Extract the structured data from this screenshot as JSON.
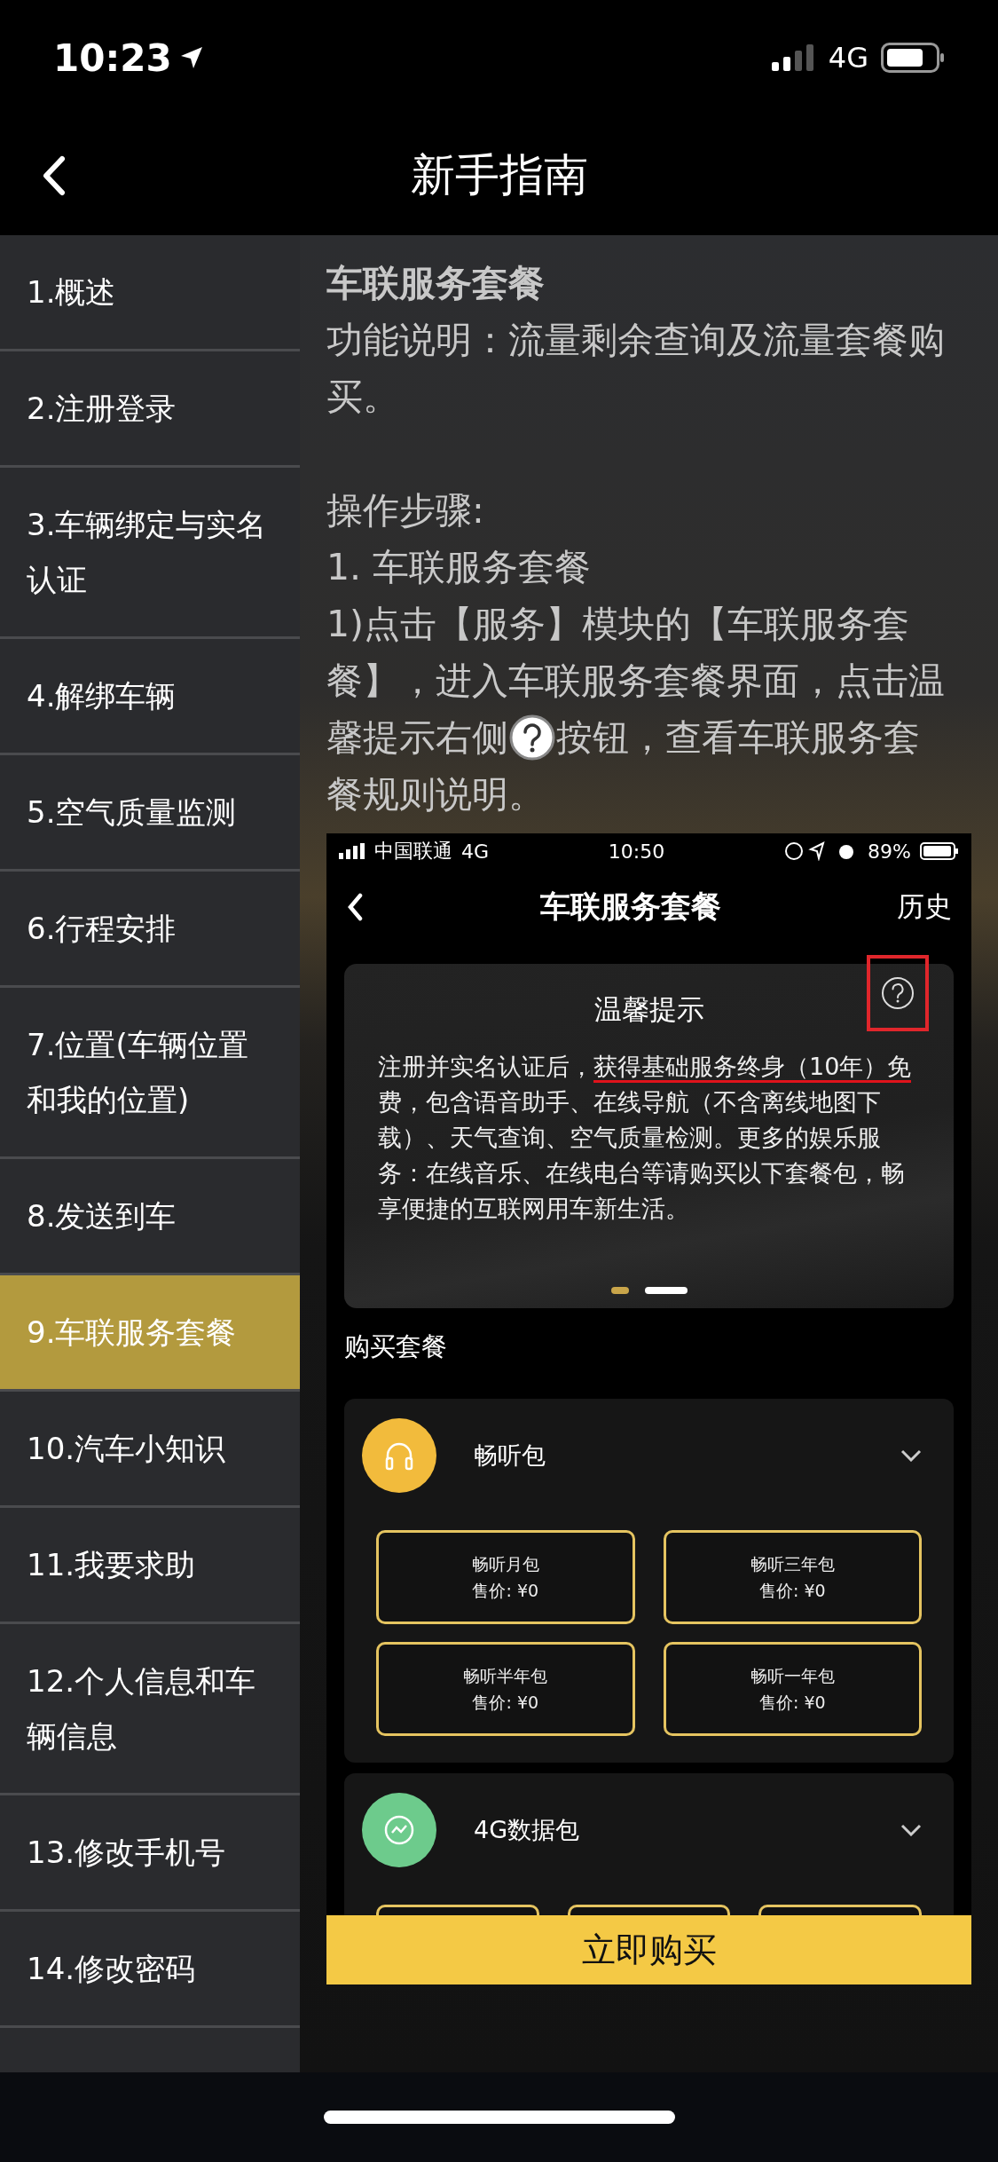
{
  "status_bar": {
    "time": "10:23",
    "network": "4G"
  },
  "nav": {
    "title": "新手指南"
  },
  "sidebar": {
    "items": [
      {
        "label": "1.概述",
        "selected": false
      },
      {
        "label": "2.注册登录",
        "selected": false
      },
      {
        "label": "3.车辆绑定与实名认证",
        "selected": false
      },
      {
        "label": "4.解绑车辆",
        "selected": false
      },
      {
        "label": "5.空气质量监测",
        "selected": false
      },
      {
        "label": "6.行程安排",
        "selected": false
      },
      {
        "label": "7.位置(车辆位置和我的位置)",
        "selected": false
      },
      {
        "label": "8.发送到车",
        "selected": false
      },
      {
        "label": "9.车联服务套餐",
        "selected": true
      },
      {
        "label": "10.汽车小知识",
        "selected": false
      },
      {
        "label": "11.我要求助",
        "selected": false
      },
      {
        "label": "12.个人信息和车辆信息",
        "selected": false
      },
      {
        "label": "13.修改手机号",
        "selected": false
      },
      {
        "label": "14.修改密码",
        "selected": false
      }
    ]
  },
  "content": {
    "heading": "车联服务套餐",
    "description": "功能说明：流量剩余查询及流量套餐购买。",
    "steps_label": "操作步骤:",
    "step_title": "1. 车联服务套餐",
    "step_lines": [
      {
        "parts": [
          {
            "kind": "text",
            "text": "1)点击【服务】模块的【车联服务套"
          }
        ]
      },
      {
        "parts": [
          {
            "kind": "text",
            "text": "餐】，进入车联服务套餐界面，点击温"
          }
        ]
      },
      {
        "parts": [
          {
            "kind": "text",
            "text": "馨提示右侧"
          },
          {
            "kind": "help_icon"
          },
          {
            "kind": "text",
            "text": "按钮，查看车联服务套"
          }
        ]
      },
      {
        "parts": [
          {
            "kind": "text",
            "text": "餐规则说明。"
          }
        ]
      }
    ]
  },
  "embedded_screenshot": {
    "status_bar": {
      "carrier": "中国联通",
      "network": "4G",
      "time": "10:50",
      "battery": "89%"
    },
    "nav": {
      "title": "车联服务套餐",
      "action": "历史"
    },
    "notice": {
      "title": "温馨提示",
      "help_highlighted": true,
      "text_parts": [
        {
          "text": "注册并实名认证后，",
          "marked": false
        },
        {
          "text": "获得基础服务终身（10年）免",
          "marked": true
        },
        {
          "text": "费，包含语音助手、在线导航（不含离线地图下载）、天气查询、空气质量检测。更多的娱乐服务：在线音乐、在线电台等请购买以下套餐包，畅享便捷的互联网用车新生活。",
          "marked": false
        }
      ]
    },
    "page_dots": [
      {
        "selected": false
      },
      {
        "selected": true
      }
    ],
    "section_label": "购买套餐",
    "groups": [
      {
        "name": "畅听包",
        "kind": "headphones",
        "color": "#f2bb3c",
        "options": [
          {
            "kind": "option",
            "name": "畅听月包",
            "price": "售价: ¥0"
          },
          {
            "kind": "option",
            "name": "畅听三年包",
            "price": "售价: ¥0"
          },
          {
            "kind": "option",
            "name": "畅听半年包",
            "price": "售价: ¥0"
          },
          {
            "kind": "option",
            "name": "畅听一年包",
            "price": "售价: ¥0"
          }
        ]
      },
      {
        "name": "4G数据包",
        "kind": "data",
        "color": "#6dcb8c",
        "options": [
          {
            "kind": "covered"
          },
          {
            "kind": "covered"
          },
          {
            "kind": "covered"
          }
        ]
      }
    ],
    "buy_button": "立即购买"
  }
}
